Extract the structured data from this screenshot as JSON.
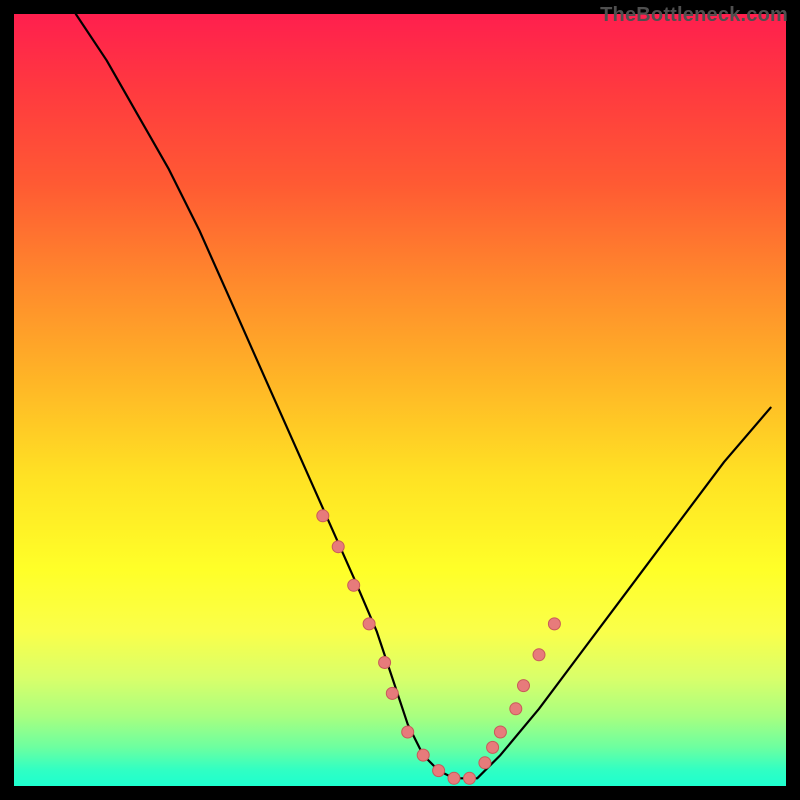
{
  "watermark": "TheBottleneck.com",
  "colors": {
    "background": "#000000",
    "curve_stroke": "#000000",
    "marker_fill": "#e77b7b",
    "marker_stroke": "#c85a5a"
  },
  "chart_data": {
    "type": "line",
    "title": "",
    "xlabel": "",
    "ylabel": "",
    "xlim": [
      0,
      100
    ],
    "ylim": [
      0,
      100
    ],
    "grid": false,
    "legend": false,
    "series": [
      {
        "name": "curve",
        "x": [
          8,
          12,
          16,
          20,
          24,
          28,
          32,
          36,
          40,
          44,
          47,
          49,
          51,
          53,
          55,
          57,
          60,
          63,
          68,
          74,
          80,
          86,
          92,
          98
        ],
        "y": [
          100,
          94,
          87,
          80,
          72,
          63,
          54,
          45,
          36,
          27,
          20,
          14,
          8,
          4,
          2,
          1,
          1,
          4,
          10,
          18,
          26,
          34,
          42,
          49
        ]
      },
      {
        "name": "markers",
        "x": [
          40,
          42,
          44,
          46,
          48,
          49,
          51,
          53,
          55,
          57,
          59,
          61,
          62,
          63,
          65,
          66,
          68,
          70
        ],
        "y": [
          35,
          31,
          26,
          21,
          16,
          12,
          7,
          4,
          2,
          1,
          1,
          3,
          5,
          7,
          10,
          13,
          17,
          21
        ]
      }
    ]
  }
}
